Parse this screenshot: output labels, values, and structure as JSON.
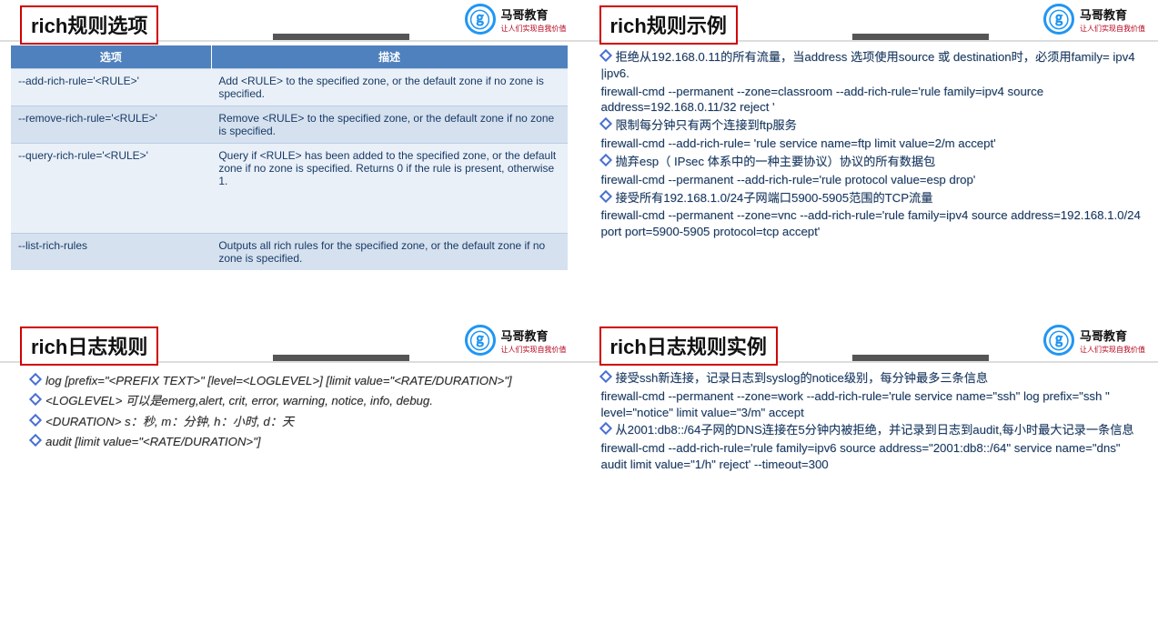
{
  "brand": {
    "mark": "ⓖ",
    "name": "马哥教育",
    "sub": "让人们实现自我价值"
  },
  "slide1": {
    "title": "rich规则选项",
    "th1": "选项",
    "th2": "描述",
    "rows": [
      {
        "opt": "--add-rich-rule='<RULE>'",
        "desc": "Add <RULE> to the specified zone, or the default zone if no zone is specified."
      },
      {
        "opt": "--remove-rich-rule='<RULE>'",
        "desc": "Remove <RULE> to the specified zone, or the default zone if no zone is specified."
      },
      {
        "opt": "--query-rich-rule='<RULE>'",
        "desc": "Query if <RULE> has been added to the specified zone, or the default zone if no zone is specified. Returns 0 if the rule is present, otherwise 1."
      },
      {
        "opt": "--list-rich-rules",
        "desc": "Outputs all rich rules for the specified zone, or the default zone if no zone is specified."
      }
    ]
  },
  "slide2": {
    "title": "rich规则示例",
    "b1": "拒绝从192.168.0.11的所有流量，当address 选项使用source 或 destination时，必须用family= ipv4 |ipv6.",
    "c1": "firewall-cmd --permanent --zone=classroom --add-rich-rule='rule family=ipv4 source address=192.168.0.11/32 reject '",
    "b2": "限制每分钟只有两个连接到ftp服务",
    "c2": "firewall-cmd --add-rich-rule= 'rule service name=ftp limit value=2/m accept'",
    "b3": "抛弃esp（ IPsec 体系中的一种主要协议）协议的所有数据包",
    "c3": "firewall-cmd --permanent --add-rich-rule='rule protocol value=esp drop'",
    "b4": "接受所有192.168.1.0/24子网端口5900-5905范围的TCP流量",
    "c4": "firewall-cmd --permanent --zone=vnc --add-rich-rule='rule family=ipv4 source address=192.168.1.0/24 port port=5900-5905 protocol=tcp accept'"
  },
  "slide3": {
    "title": "rich日志规则",
    "l1": "log [prefix=\"<PREFIX TEXT>\" [level=<LOGLEVEL>] [limit value=\"<RATE/DURATION>\"]",
    "l2": "<LOGLEVEL> 可以是emerg,alert, crit, error, warning, notice, info, debug.",
    "l3": "<DURATION> s：秒, m：分钟, h：小时, d：天",
    "l4": "audit [limit value=\"<RATE/DURATION>\"]"
  },
  "slide4": {
    "title": "rich日志规则实例",
    "b1": "接受ssh新连接，记录日志到syslog的notice级别，每分钟最多三条信息",
    "c1": "firewall-cmd --permanent --zone=work --add-rich-rule='rule service name=\"ssh\" log prefix=\"ssh \" level=\"notice\" limit value=\"3/m\" accept",
    "b2": "从2001:db8::/64子网的DNS连接在5分钟内被拒绝，并记录到日志到audit,每小时最大记录一条信息",
    "c2": "firewall-cmd --add-rich-rule='rule family=ipv6 source address=\"2001:db8::/64\" service name=\"dns\" audit limit value=\"1/h\" reject' --timeout=300"
  }
}
